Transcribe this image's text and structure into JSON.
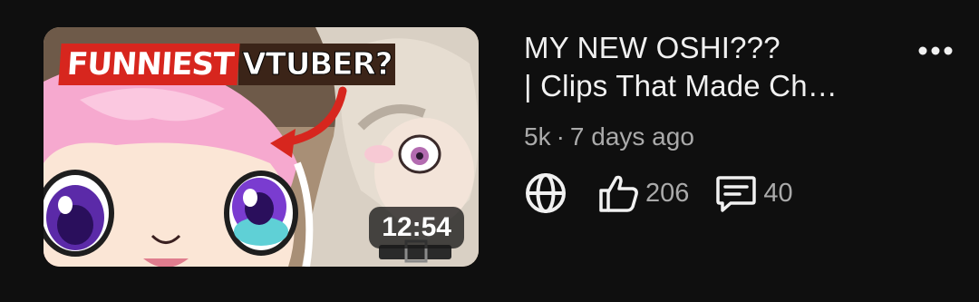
{
  "video": {
    "title_line1": "MY NEW OSHI???",
    "title_line2": "| Clips That Made Ch…",
    "views": "5k",
    "separator": "·",
    "age": "7 days ago",
    "duration": "12:54",
    "likes": "206",
    "comments": "40",
    "thumbnail_caption": {
      "red_text": "FUNNIEST",
      "white_text": "VTUBER?"
    }
  },
  "icons": {
    "visibility": "globe-icon",
    "likes": "thumbs-up-icon",
    "comments": "comment-icon",
    "menu": "more-vertical-icon"
  },
  "colors": {
    "background": "#0f0f0f",
    "text_primary": "#f1f1f1",
    "text_secondary": "#aaaaaa",
    "caption_red": "#d7261e"
  }
}
